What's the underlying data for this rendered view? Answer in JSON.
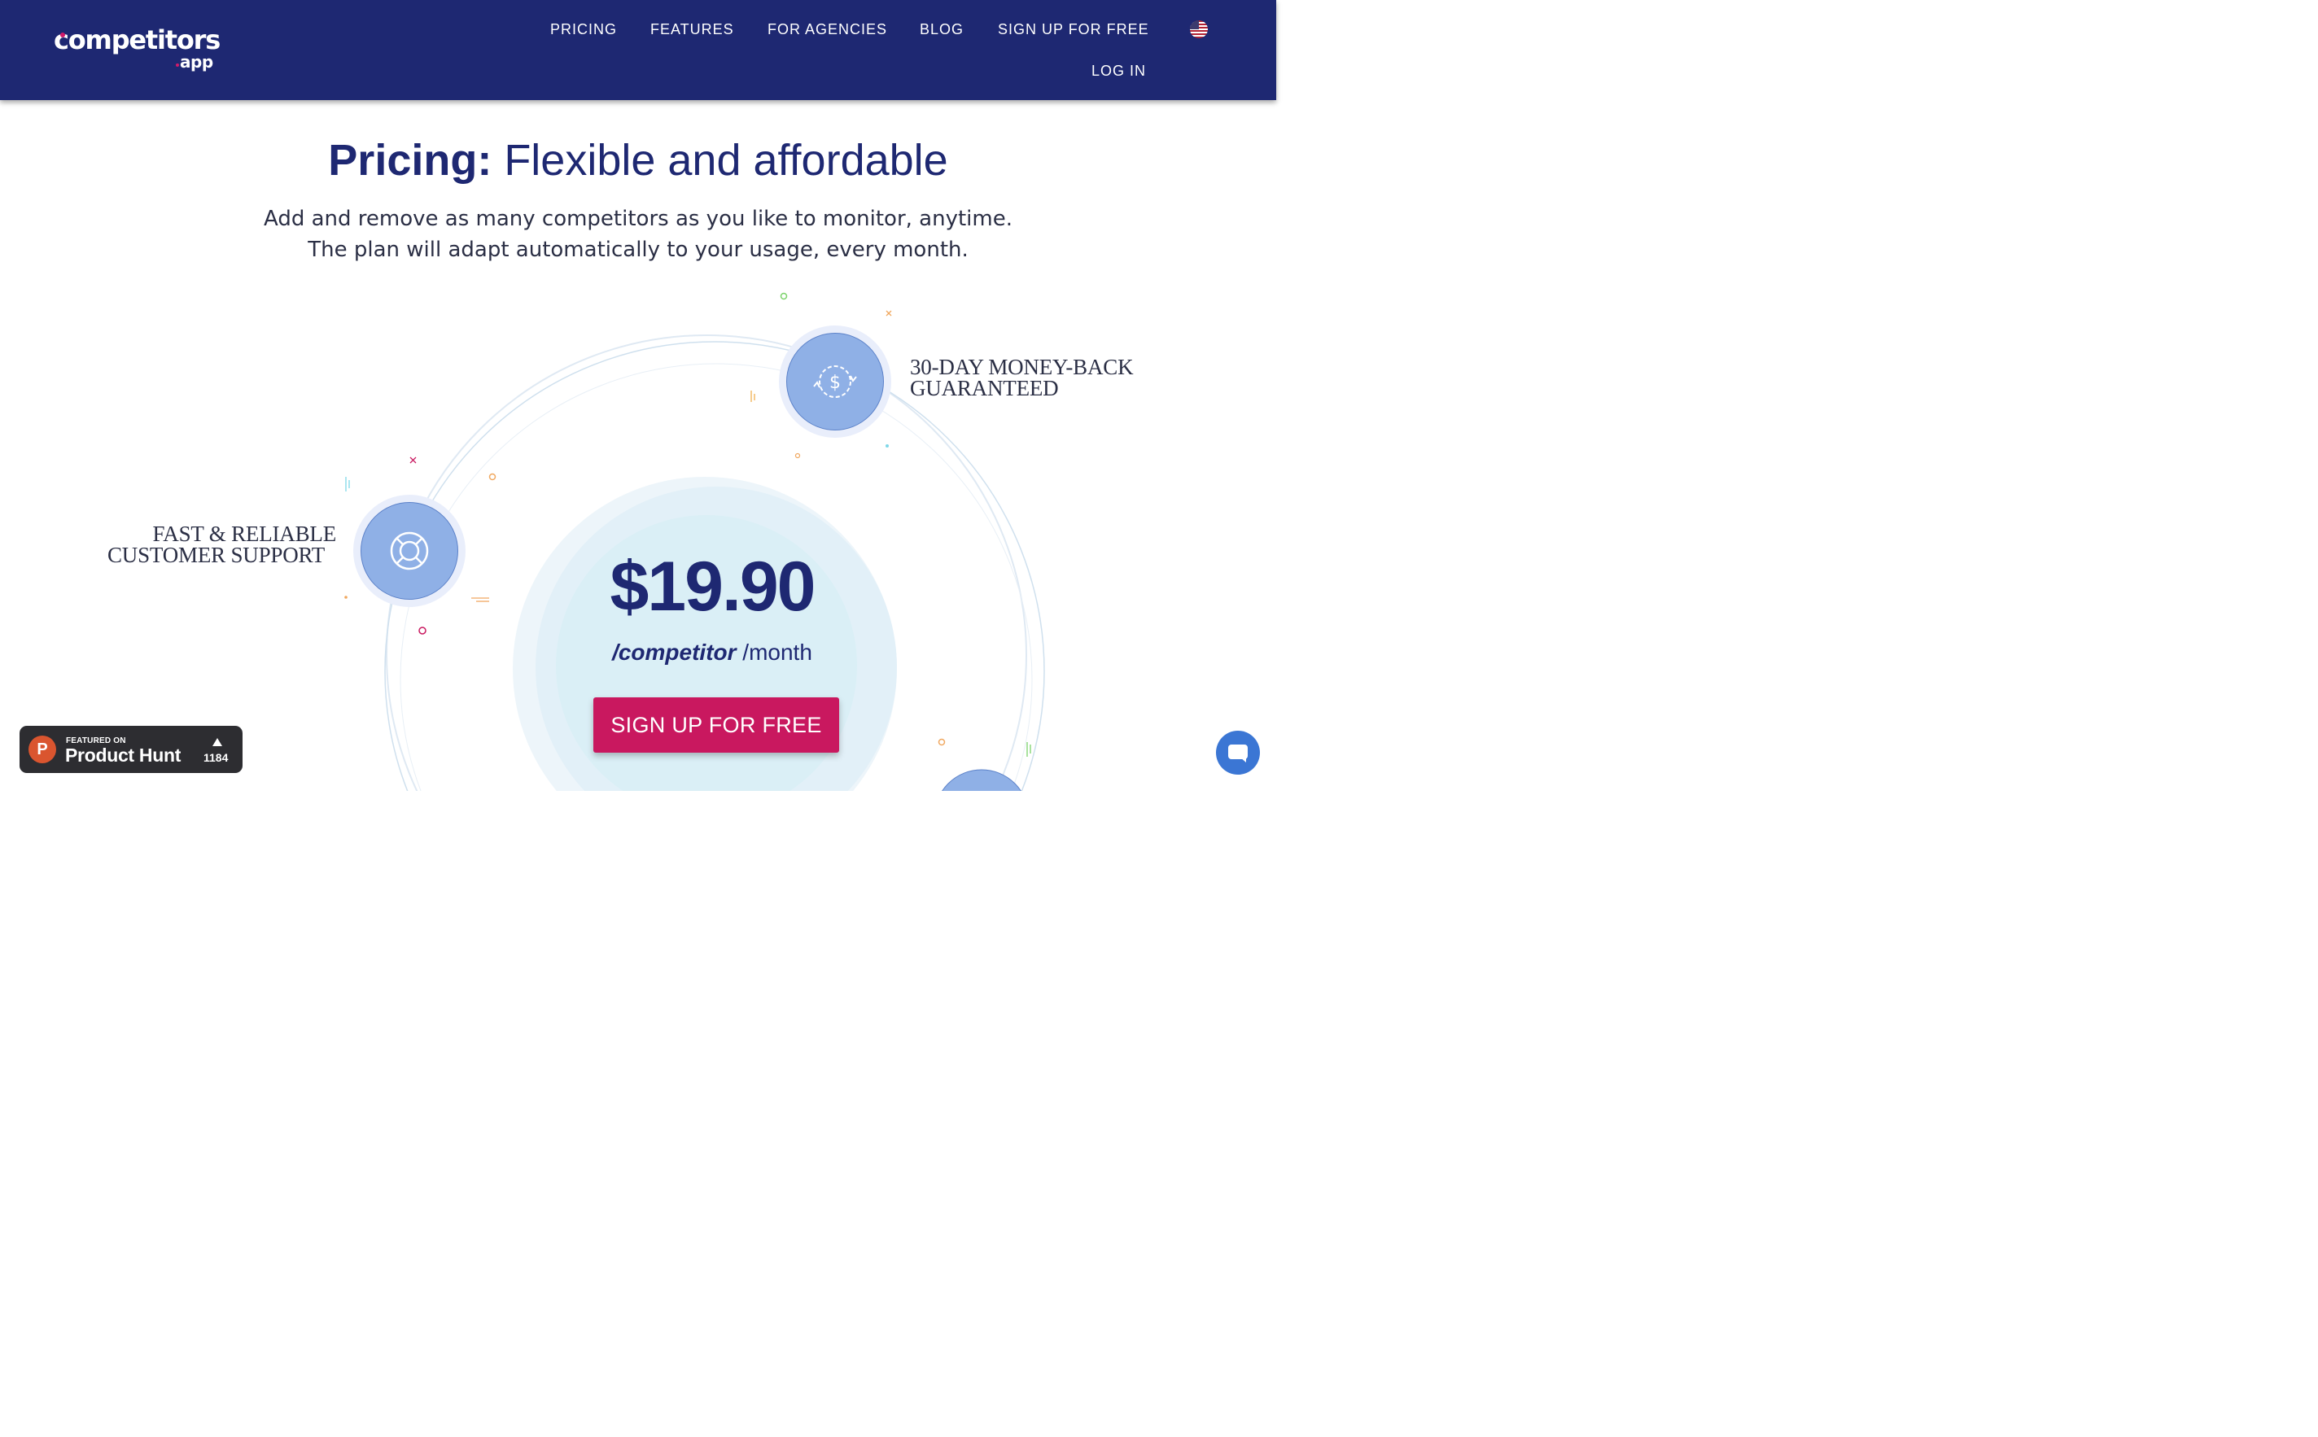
{
  "header": {
    "logo": {
      "main": "competitors",
      "sub": "app"
    },
    "nav": {
      "pricing": "PRICING",
      "features": "FEATURES",
      "agencies": "FOR AGENCIES",
      "blog": "BLOG",
      "signup": "SIGN UP FOR FREE",
      "login": "LOG IN"
    },
    "language_icon": "us-flag-icon"
  },
  "hero": {
    "title_bold": "Pricing:",
    "title_rest": " Flexible and affordable",
    "subtitle_line1": "Add and remove as many competitors as you like to monitor, anytime.",
    "subtitle_line2": "The plan will adapt automatically to your usage, every month."
  },
  "features": {
    "guarantee_line1": "30-DAY MONEY-BACK",
    "guarantee_line2": "GUARANTEED",
    "support_line1": "FAST & RELIABLE",
    "support_line2": "CUSTOMER SUPPORT"
  },
  "plan": {
    "price": "$19.90",
    "per_bold": "/competitor",
    "per_rest": " /month",
    "cta": "SIGN UP FOR FREE"
  },
  "product_hunt": {
    "small": "FEATURED ON",
    "big": "Product Hunt",
    "logo_letter": "P",
    "count": "1184"
  },
  "colors": {
    "header_bg": "#1e2872",
    "accent": "#c9185f",
    "feature_circle": "#8fb0e6",
    "price_circle": "#daeff6"
  }
}
